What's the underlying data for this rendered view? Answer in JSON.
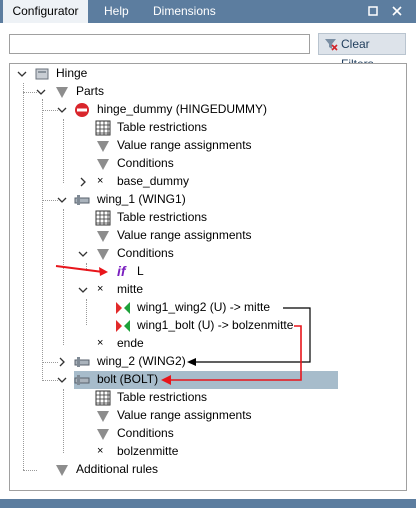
{
  "tabs": [
    {
      "label": "Configurator",
      "active": true
    },
    {
      "label": "Help",
      "active": false
    },
    {
      "label": "Dimensions",
      "active": false
    }
  ],
  "window_buttons": [
    "restore-icon",
    "close-icon"
  ],
  "search": {
    "value": "",
    "placeholder": ""
  },
  "clear_filters_label": "Clear Filters",
  "tree": {
    "root": "Hinge",
    "parts": "Parts",
    "hinge_dummy": "hinge_dummy (HINGEDUMMY)",
    "hd_table": "Table restrictions",
    "hd_value": "Value range assignments",
    "hd_conditions": "Conditions",
    "hd_base": "base_dummy",
    "wing1": "wing_1 (WING1)",
    "w1_table": "Table restrictions",
    "w1_value": "Value range assignments",
    "w1_conditions": "Conditions",
    "w1_if_value": "L",
    "w1_if_glyph": "if",
    "w1_mitte": "mitte",
    "w1_m1": "wing1_wing2 (U) -> mitte",
    "w1_m2": "wing1_bolt (U) -> bolzenmitte",
    "w1_ende": "ende",
    "wing2": "wing_2 (WING2)",
    "bolt": "bolt (BOLT)",
    "b_table": "Table restrictions",
    "b_value": "Value range assignments",
    "b_conditions": "Conditions",
    "b_bolzen": "bolzenmitte",
    "additional": "Additional rules"
  },
  "colors": {
    "header": "#5c7d9f",
    "selection": "#a7bccb",
    "arrow": "#e8151b"
  }
}
